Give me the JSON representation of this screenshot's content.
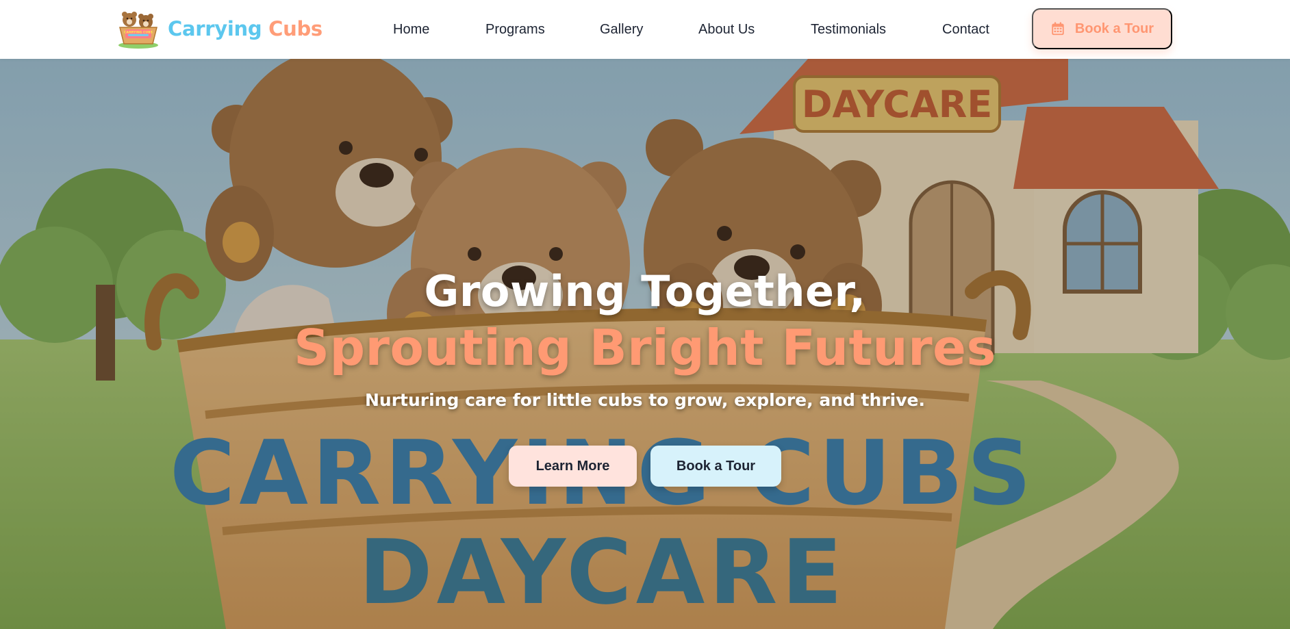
{
  "navbar": {
    "brand": {
      "part1": "Carrying",
      "part2": "Cubs",
      "logo_icon": "bear-cubs-basket-logo",
      "logo_text": "CARRYING CUBS"
    },
    "links": [
      {
        "label": "Home"
      },
      {
        "label": "Programs"
      },
      {
        "label": "Gallery"
      },
      {
        "label": "About Us"
      },
      {
        "label": "Testimonials"
      },
      {
        "label": "Contact"
      }
    ],
    "cta": {
      "label": "Book a Tour",
      "icon": "calendar-icon"
    }
  },
  "hero": {
    "title_line1": "Growing Together,",
    "title_line2": "Sprouting Bright Futures",
    "subtitle": "Nurturing care for little cubs to grow, explore, and thrive.",
    "buttons": {
      "learn_more": "Learn More",
      "book_tour": "Book a Tour"
    },
    "illustration": {
      "sign_text": "DAYCARE",
      "basket_line1": "CARRYING CUBS",
      "basket_line2": "DAYCARE"
    }
  },
  "colors": {
    "brand_blue": "#5cc7ee",
    "brand_orange": "#ff9d78",
    "cta_bg": "#ffddd2",
    "cta_text": "#ff9672",
    "hero_accent": "#ff9a73",
    "learn_btn_bg": "#ffe3dd",
    "tour_btn_bg": "#d7f2fb",
    "nav_text": "#1d2433"
  }
}
